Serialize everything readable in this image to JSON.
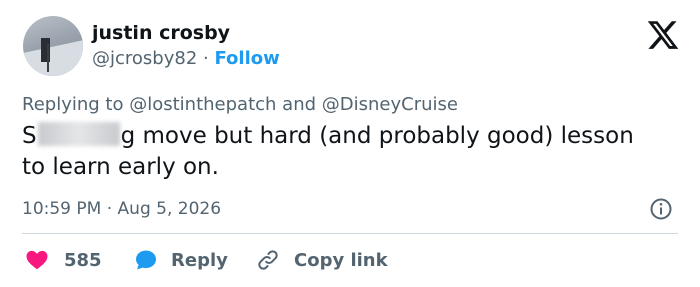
{
  "user": {
    "name": "justin crosby",
    "handle": "@jcrosby82",
    "separator": "·",
    "follow_label": "Follow"
  },
  "reply_context": {
    "prefix": "Replying to",
    "mention1": "@lostinthepatch",
    "conjunction": "and",
    "mention2": "@DisneyCruise"
  },
  "tweet": {
    "text_start": "S",
    "text_rest": "g move but hard (and probably good) lesson to learn early on."
  },
  "timestamp": {
    "time": "10:59 PM",
    "separator": "·",
    "date": "Aug 5, 2026"
  },
  "actions": {
    "likes_count": "585",
    "reply_label": "Reply",
    "copy_link_label": "Copy link"
  },
  "colors": {
    "like": "#f91880",
    "reply_icon": "#1d9bf0",
    "follow": "#1d9bf0",
    "muted": "#536471"
  },
  "icons": [
    "x-logo-icon",
    "info-icon",
    "heart-icon",
    "reply-bubble-icon",
    "link-icon"
  ]
}
